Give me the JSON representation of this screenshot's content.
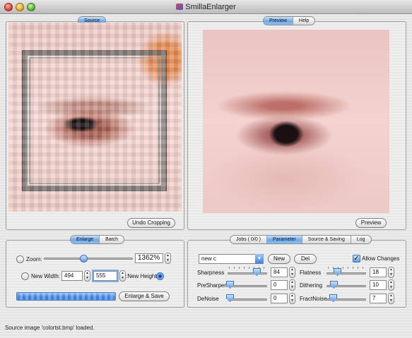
{
  "window": {
    "title": "SmillaEnlarger"
  },
  "source_panel": {
    "tab_label": "Source",
    "undo_cropping_label": "Undo Cropping"
  },
  "preview_panel": {
    "tabs": [
      {
        "label": "Preview",
        "selected": true
      },
      {
        "label": "Help",
        "selected": false
      }
    ],
    "preview_button_label": "Preview"
  },
  "enlarge_panel": {
    "tabs": [
      {
        "label": "Enlarge",
        "selected": true
      },
      {
        "label": "Batch",
        "selected": false
      }
    ],
    "zoom_label": "Zoom:",
    "zoom_value": "1362%",
    "new_width_label": "New Width:",
    "new_width_value": "494",
    "new_height_value": "555",
    "new_height_label": ":New Height",
    "enlarge_save_label": "Enlarge & Save",
    "selected_mode": "new_height"
  },
  "parameter_panel": {
    "tabs": [
      {
        "label": "Jobs ( 0/0 )",
        "selected": false
      },
      {
        "label": "Parameter",
        "selected": true
      },
      {
        "label": "Source & Saving",
        "selected": false
      },
      {
        "label": "Log",
        "selected": false
      }
    ],
    "preset_value": "new c",
    "new_label": "New",
    "del_label": "Del",
    "allow_changes_label": "Allow Changes",
    "allow_changes_checked": true,
    "params_left": [
      {
        "label": "Sharpness",
        "value": "84"
      },
      {
        "label": "PreSharpen",
        "value": "0"
      },
      {
        "label": "DeNoise",
        "value": "0"
      }
    ],
    "params_right": [
      {
        "label": "Flatness",
        "value": "18"
      },
      {
        "label": "Dithering",
        "value": "10"
      },
      {
        "label": "FractNoise",
        "value": "7"
      }
    ]
  },
  "status_bar": {
    "text": "Source image 'colortst.bmp' loaded."
  },
  "colors": {
    "accent": "#5d9ae6",
    "progress": "#3f7fd8"
  },
  "icons": [
    "close-window-icon",
    "minimize-window-icon",
    "zoom-window-icon",
    "app-icon",
    "chevron-down-icon",
    "checkmark-icon"
  ]
}
